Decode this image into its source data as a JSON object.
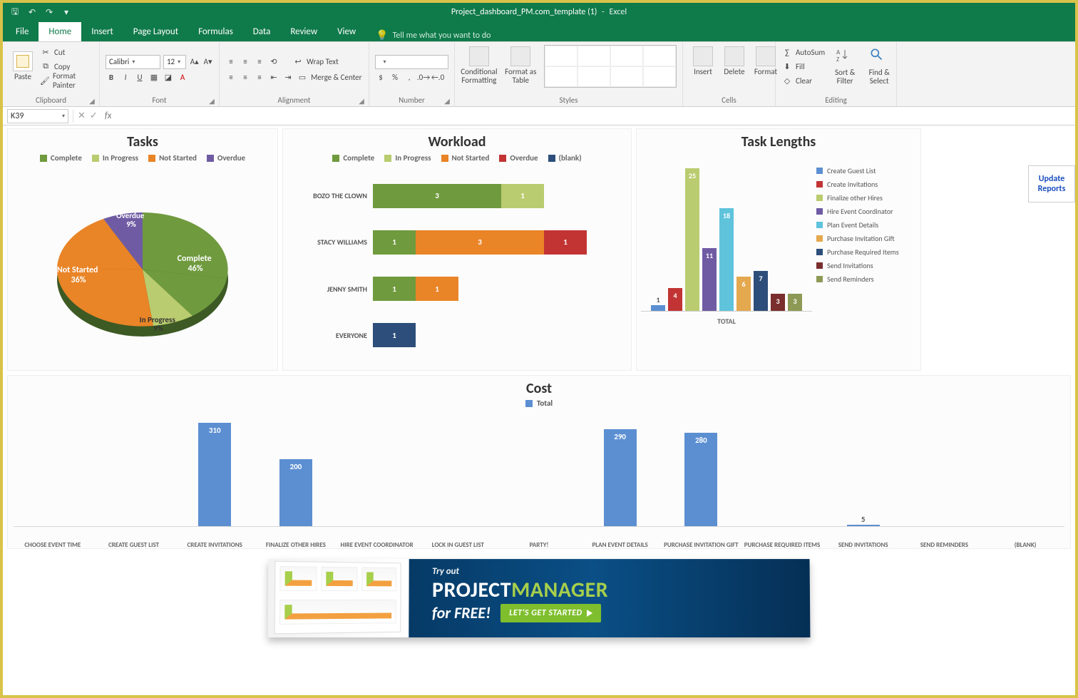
{
  "app": {
    "workbook_title": "Project_dashboard_PM.com_template (1)",
    "app_name": "Excel"
  },
  "tabs": {
    "file": "File",
    "items": [
      "Home",
      "Insert",
      "Page Layout",
      "Formulas",
      "Data",
      "Review",
      "View"
    ],
    "active": "Home",
    "tell_me": "Tell me what you want to do"
  },
  "ribbon": {
    "clipboard": {
      "label": "Clipboard",
      "paste": "Paste",
      "cut": "Cut",
      "copy": "Copy",
      "format_painter": "Format Painter"
    },
    "font": {
      "label": "Font",
      "family": "Calibri",
      "size": "12"
    },
    "alignment": {
      "label": "Alignment",
      "wrap": "Wrap Text",
      "merge": "Merge & Center"
    },
    "number": {
      "label": "Number"
    },
    "styles": {
      "label": "Styles",
      "cond": "Conditional\nFormatting",
      "table": "Format as\nTable"
    },
    "cells": {
      "label": "Cells",
      "insert": "Insert",
      "delete": "Delete",
      "format": "Format"
    },
    "editing": {
      "label": "Editing",
      "autosum": "AutoSum",
      "fill": "Fill",
      "clear": "Clear",
      "sort": "Sort &\nFilter",
      "find": "Find &\nSelect"
    }
  },
  "formula_bar": {
    "name_box": "K39",
    "fx_label": "fx"
  },
  "colors": {
    "complete": "#6f9a3e",
    "inprogress": "#b9cc6f",
    "notstarted": "#e98427",
    "overdue": "#c23434",
    "blank": "#2d4e7a",
    "purple": "#6f5ba3",
    "cyan": "#5fc3dc",
    "tan": "#e4a84e",
    "darkred": "#7a2e2e",
    "olive": "#8d9a56",
    "blue": "#5c8fd2"
  },
  "dashboard": {
    "update_button": "Update\nReports",
    "tasks_title": "Tasks",
    "workload_title": "Workload",
    "tasklengths_title": "Task Lengths",
    "cost_title": "Cost",
    "legend_status": [
      "Complete",
      "In Progress",
      "Not Started",
      "Overdue"
    ],
    "legend_status_blank": [
      "Complete",
      "In Progress",
      "Not Started",
      "Overdue",
      "(blank)"
    ],
    "cost_legend": "Total",
    "tasklengths_xlabel": "TOTAL"
  },
  "chart_data": [
    {
      "id": "tasks_pie",
      "type": "pie",
      "title": "Tasks",
      "slices": [
        {
          "label": "Complete",
          "value": 46,
          "display": "Complete\n46%",
          "color": "#6f9a3e"
        },
        {
          "label": "In Progress",
          "value": 9,
          "display": "In Progress\n9%",
          "color": "#b9cc6f"
        },
        {
          "label": "Not Started",
          "value": 36,
          "display": "Not Started\n36%",
          "color": "#e98427"
        },
        {
          "label": "Overdue",
          "value": 9,
          "display": "Overdue\n9%",
          "color": "#6f5ba3"
        }
      ]
    },
    {
      "id": "workload",
      "type": "bar",
      "orientation": "horizontal",
      "stacked": true,
      "title": "Workload",
      "categories": [
        "BOZO THE CLOWN",
        "STACY WILLIAMS",
        "JENNY SMITH",
        "EVERYONE"
      ],
      "series": [
        {
          "name": "Complete",
          "color": "#6f9a3e",
          "values": [
            3,
            1,
            1,
            0
          ]
        },
        {
          "name": "In Progress",
          "color": "#b9cc6f",
          "values": [
            1,
            0,
            0,
            0
          ]
        },
        {
          "name": "Not Started",
          "color": "#e98427",
          "values": [
            0,
            3,
            1,
            0
          ]
        },
        {
          "name": "Overdue",
          "color": "#c23434",
          "values": [
            0,
            1,
            0,
            0
          ]
        },
        {
          "name": "(blank)",
          "color": "#2d4e7a",
          "values": [
            0,
            0,
            0,
            1
          ]
        }
      ],
      "xlim": [
        0,
        5
      ]
    },
    {
      "id": "task_lengths",
      "type": "bar",
      "title": "Task Lengths",
      "xlabel": "TOTAL",
      "legend": [
        {
          "name": "Create Guest List",
          "color": "#5c8fd2",
          "value": 1
        },
        {
          "name": "Create Invitations",
          "color": "#c23434",
          "value": 4
        },
        {
          "name": "Finalize other Hires",
          "color": "#b9cc6f",
          "value": 25
        },
        {
          "name": "Hire Event Coordinator",
          "color": "#6f5ba3",
          "value": 11
        },
        {
          "name": "Plan Event Details",
          "color": "#5fc3dc",
          "value": 18
        },
        {
          "name": "Purchase Invitation Gift",
          "color": "#e4a84e",
          "value": 6
        },
        {
          "name": "Purchase Required Items",
          "color": "#2d4e7a",
          "value": 7
        },
        {
          "name": "Send Invitations",
          "color": "#7a2e2e",
          "value": 3
        },
        {
          "name": "Send Reminders",
          "color": "#8d9a56",
          "value": 3
        }
      ],
      "ylim": [
        0,
        25
      ]
    },
    {
      "id": "cost",
      "type": "bar",
      "title": "Cost",
      "series_name": "Total",
      "categories": [
        "CHOOSE EVENT TIME",
        "CREATE GUEST LIST",
        "CREATE INVITATIONS",
        "FINALIZE OTHER HIRES",
        "HIRE EVENT COORDINATOR",
        "LOCK IN GUEST LIST",
        "PARTY!",
        "PLAN EVENT DETAILS",
        "PURCHASE INVITATION GIFT",
        "PURCHASE REQUIRED ITEMS",
        "SEND INVITATIONS",
        "SEND REMINDERS",
        "(BLANK)"
      ],
      "values": [
        0,
        0,
        310,
        200,
        0,
        0,
        0,
        290,
        280,
        0,
        5,
        0,
        0
      ],
      "ylim": [
        0,
        320
      ],
      "color": "#5c8fd2"
    }
  ],
  "banner": {
    "line1": "Try out",
    "line2a": "PROJECT",
    "line2b": "MANAGER",
    "line3": "for FREE!",
    "cta": "LET'S GET STARTED"
  }
}
